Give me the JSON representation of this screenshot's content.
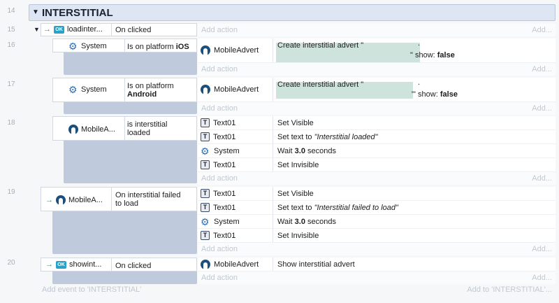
{
  "line_numbers": [
    "14",
    "15",
    "16",
    "17",
    "18",
    "19",
    "20"
  ],
  "group": {
    "title": "INTERSTITIAL"
  },
  "events": {
    "e15": {
      "object": "loadinter...",
      "condition": "On clicked",
      "add_action": "Add action",
      "add": "Add..."
    },
    "e16": {
      "object": "System",
      "condition": "Is on platform",
      "platform": "iOS",
      "action_object": "MobileAdvert",
      "action_text": "Create interstitial advert \"",
      "tail": "\" show:",
      "flag": "false",
      "dot": ".",
      "add_action": "Add action",
      "add": "Add..."
    },
    "e17": {
      "object": "System",
      "condition_line1": "Is on platform",
      "platform": "Android",
      "action_object": "MobileAdvert",
      "action_text": "Create interstitial advert \"",
      "tail": "\"' show:",
      "flag": "false",
      "dot": ".",
      "add_action": "Add action",
      "add": "Add..."
    },
    "e18": {
      "object": "MobileA...",
      "condition_line1": "is interstitial",
      "condition_line2": "loaded",
      "actions": [
        {
          "object": "Text01",
          "text": "Set Visible"
        },
        {
          "object": "Text01",
          "text_prefix": "Set text to ",
          "text_italic": "\"Interstitial loaded\""
        },
        {
          "object": "System",
          "text_prefix": "Wait ",
          "text_bold": "3.0",
          "text_suffix": " seconds"
        },
        {
          "object": "Text01",
          "text": "Set Invisible"
        }
      ],
      "add_action": "Add action",
      "add": "Add..."
    },
    "e19": {
      "object": "MobileA...",
      "condition_line1": "On interstitial failed",
      "condition_line2": "to load",
      "actions": [
        {
          "object": "Text01",
          "text": "Set Visible"
        },
        {
          "object": "Text01",
          "text_prefix": "Set text to ",
          "text_italic": "\"Interstitial failed to load\""
        },
        {
          "object": "System",
          "text_prefix": "Wait ",
          "text_bold": "3.0",
          "text_suffix": " seconds"
        },
        {
          "object": "Text01",
          "text": "Set Invisible"
        }
      ],
      "add_action": "Add action",
      "add": "Add..."
    },
    "e20": {
      "object": "showint...",
      "condition": "On clicked",
      "action_object": "MobileAdvert",
      "action_text": "Show interstitial advert",
      "add_action": "Add action",
      "add": "Add..."
    }
  },
  "footer": {
    "left": "Add event to 'INTERSTITIAL'",
    "right": "Add to 'INTERSTITIAL'..."
  },
  "icons": {
    "ok_badge": "OK",
    "text_badge": "T"
  }
}
